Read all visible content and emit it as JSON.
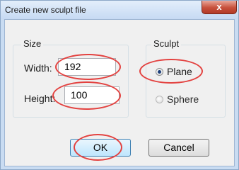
{
  "window": {
    "title": "Create new sculpt file",
    "close_label": "x"
  },
  "size_group": {
    "legend": "Size",
    "width_label": "Width:",
    "width_value": "192",
    "height_label": "Height:",
    "height_value": "100"
  },
  "sculpt_group": {
    "legend": "Sculpt",
    "options": [
      {
        "label": "Plane",
        "selected": true
      },
      {
        "label": "Sphere",
        "selected": false
      }
    ]
  },
  "buttons": {
    "ok_label": "OK",
    "cancel_label": "Cancel"
  },
  "colors": {
    "highlight_ring": "#e3413f",
    "titlebar": "#c6daf3",
    "close": "#c7503b"
  }
}
